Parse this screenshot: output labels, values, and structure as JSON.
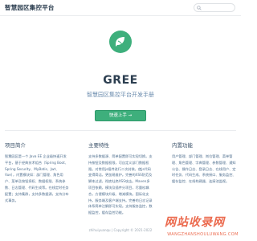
{
  "navbar": {
    "brand": "智慧园区集控平台",
    "search_placeholder": ""
  },
  "hero": {
    "title": "GREE",
    "tagline": "智慧园区集控平台开发手册",
    "cta_label": "快速上手 →"
  },
  "features": [
    {
      "title": "项目简介",
      "text": "智慧园区是一个 Java EE 企业级快速开发平台，基于经典技术组合（Spring Boot、Spring Security、MyBatis、Jwt、Vue），内置模块如：部门管理、角色用户、菜单及按钮授权、数据权限、系统参数、日志管理、代码生成等。在线定时任务配置；支持集群，支持多数据源，支持分布式事务。"
    },
    {
      "title": "主要特性",
      "text": "支持多数据源、简单配置即可实现切换。支持按钮及数据权限，可自定义部门数据权限。对常用js插件进行二次封装，使js代码变得简洁，更加易维护。完善的XSS防范及脚本过滤，彻底杜绝XSS攻击。Maven多项目依赖，模块及插件分项目，尽量松耦合，方便模块升级、增减模块。国际化支持，服务端及客户端支持。完善的日志记录体系简单注解即可实现。支持服务监控，数据监控，缓存监控功能。"
    },
    {
      "title": "内置功能",
      "text": "用户管理、部门管理、岗位管理、菜单管理、角色管理、字典管理、参数管理、通知公告、操作日志、登录日志、在线用户、定时任务、代码生成、系统接口、服务监控、缓存监控、在线构建器、连接池监视。"
    }
  ],
  "footer": {
    "text": "zhihuiyuanqu | Copyright © 2021-2022"
  },
  "watermark": {
    "text_zh": "网站收录网",
    "text_en": "WANGZHANSHOULUWANG.COM"
  },
  "colors": {
    "accent": "#3eaf7c",
    "watermark": "#e8502f"
  }
}
